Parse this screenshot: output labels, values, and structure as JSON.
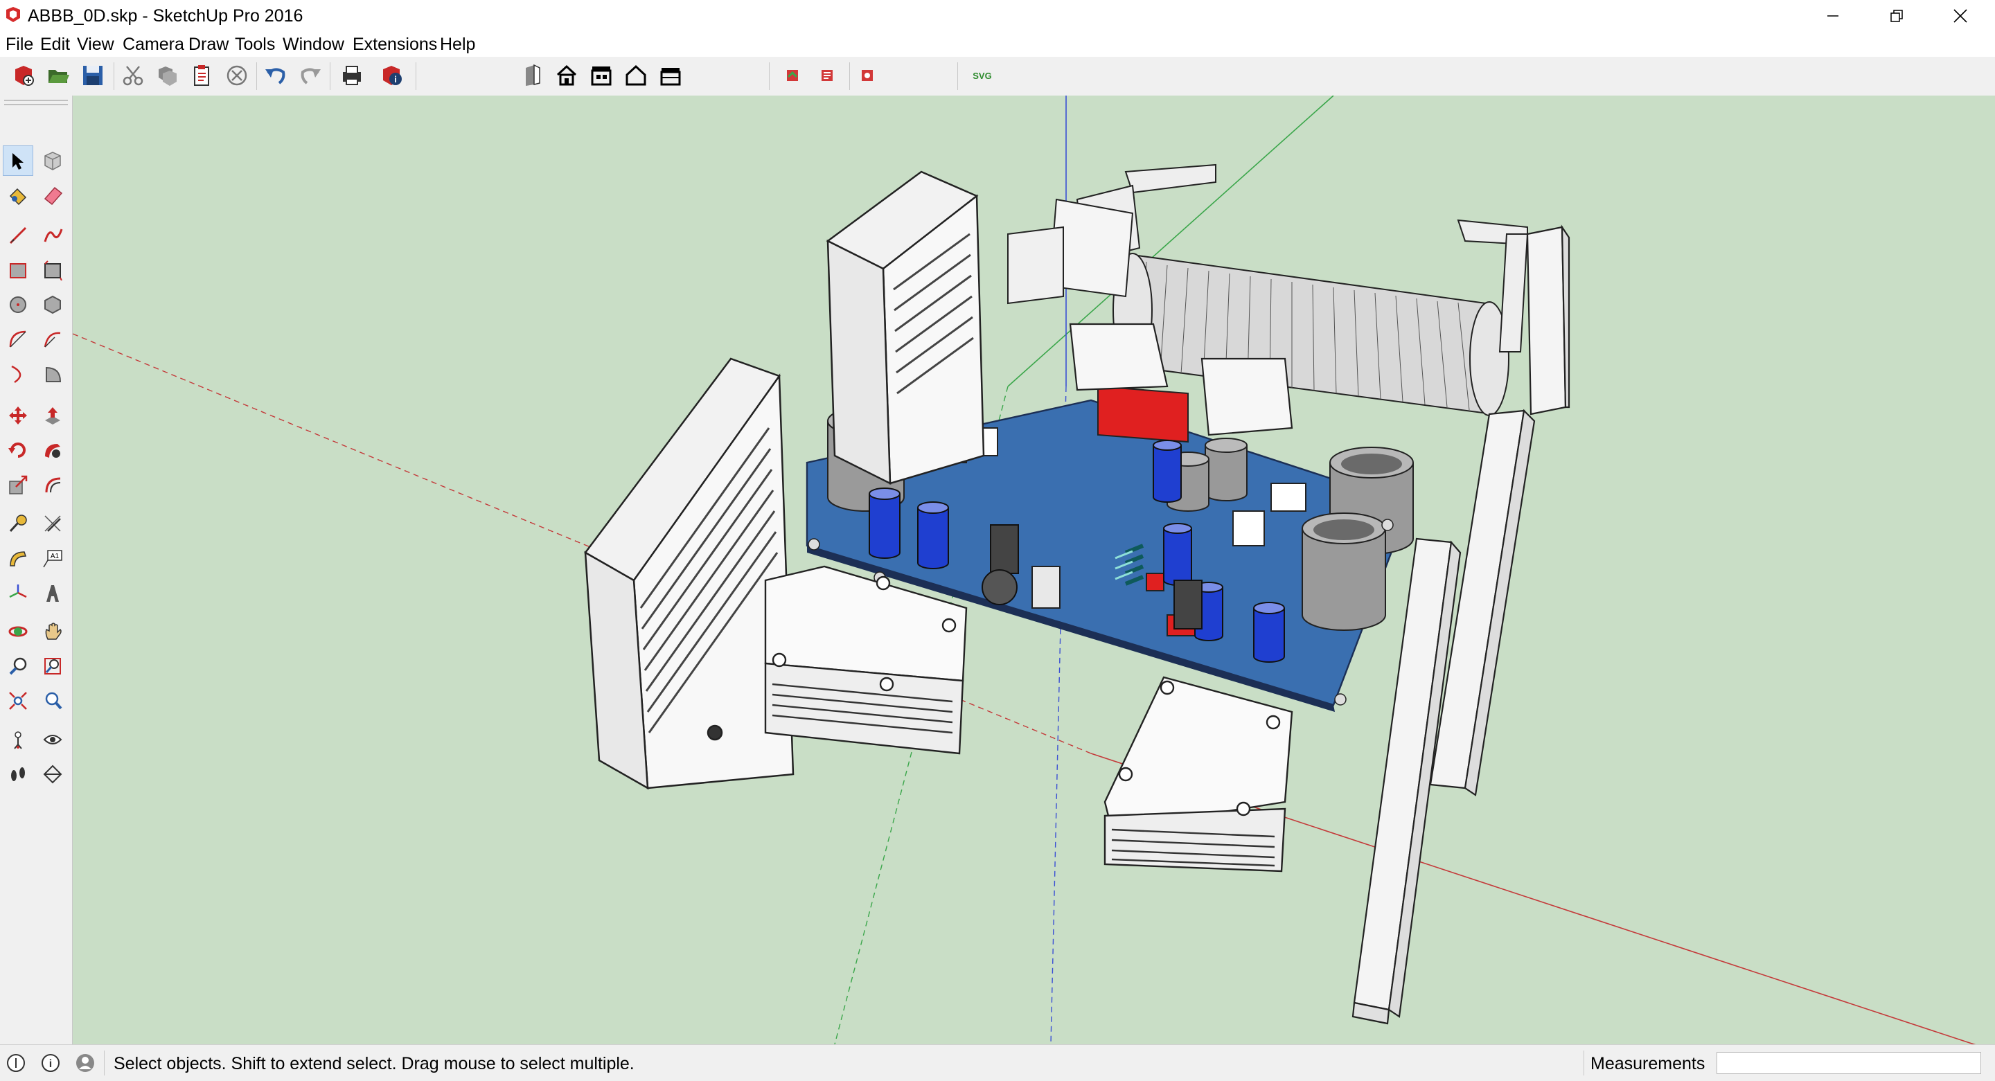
{
  "window": {
    "title": "ABBB_0D.skp - SketchUp Pro 2016",
    "icon": "sketchup-logo-icon",
    "controls": [
      "minimize-icon",
      "restore-icon",
      "close-icon"
    ]
  },
  "menubar": {
    "items": [
      "File",
      "Edit",
      "View",
      "Camera",
      "Draw",
      "Tools",
      "Window",
      "Extensions",
      "Help"
    ]
  },
  "toolbar": {
    "svg_label": "SVG",
    "buttons": [
      "new-file-icon",
      "open-folder-icon",
      "save-icon",
      "cut-icon",
      "copy-icon",
      "paste-icon",
      "erase-icon",
      "undo-icon",
      "redo-icon",
      "print-icon",
      "model-info-icon",
      "iso-view-icon",
      "top-view-icon",
      "front-view-icon",
      "right-view-icon",
      "back-view-icon",
      "export-a-icon",
      "export-b-icon",
      "export-c-icon",
      "svg-export-icon"
    ]
  },
  "left_toolbar": {
    "tools": [
      "select-icon",
      "make-component-icon",
      "paint-bucket-icon",
      "eraser-icon",
      "line-icon",
      "freehand-icon",
      "rectangle-icon",
      "rotated-rectangle-icon",
      "circle-icon",
      "polygon-icon",
      "arc-icon",
      "two-point-arc-icon",
      "three-point-arc-icon",
      "pie-icon",
      "move-icon",
      "push-pull-icon",
      "rotate-icon",
      "follow-me-icon",
      "scale-icon",
      "offset-icon",
      "tape-measure-icon",
      "dimension-icon",
      "protractor-icon",
      "text-icon",
      "axes-icon",
      "3d-text-icon",
      "orbit-icon",
      "pan-icon",
      "zoom-icon",
      "zoom-window-icon",
      "zoom-extents-icon",
      "previous-view-icon",
      "position-camera-icon",
      "look-around-icon",
      "walk-icon",
      "section-plane-icon"
    ],
    "text_tool_label": "A1"
  },
  "viewport": {
    "background": "#c9dec6",
    "axis_colors": {
      "red": "#c43a3a",
      "green": "#3aa64a",
      "blue": "#3a4fd4"
    },
    "pcb_color": "#3a6fb0",
    "model_description": "3D amplifier assembly with PCB, capacitors, radiators and cable"
  },
  "statusbar": {
    "hint": "Select objects. Shift to extend select. Drag mouse to select multiple.",
    "measurements_label": "Measurements",
    "measurements_value": ""
  }
}
